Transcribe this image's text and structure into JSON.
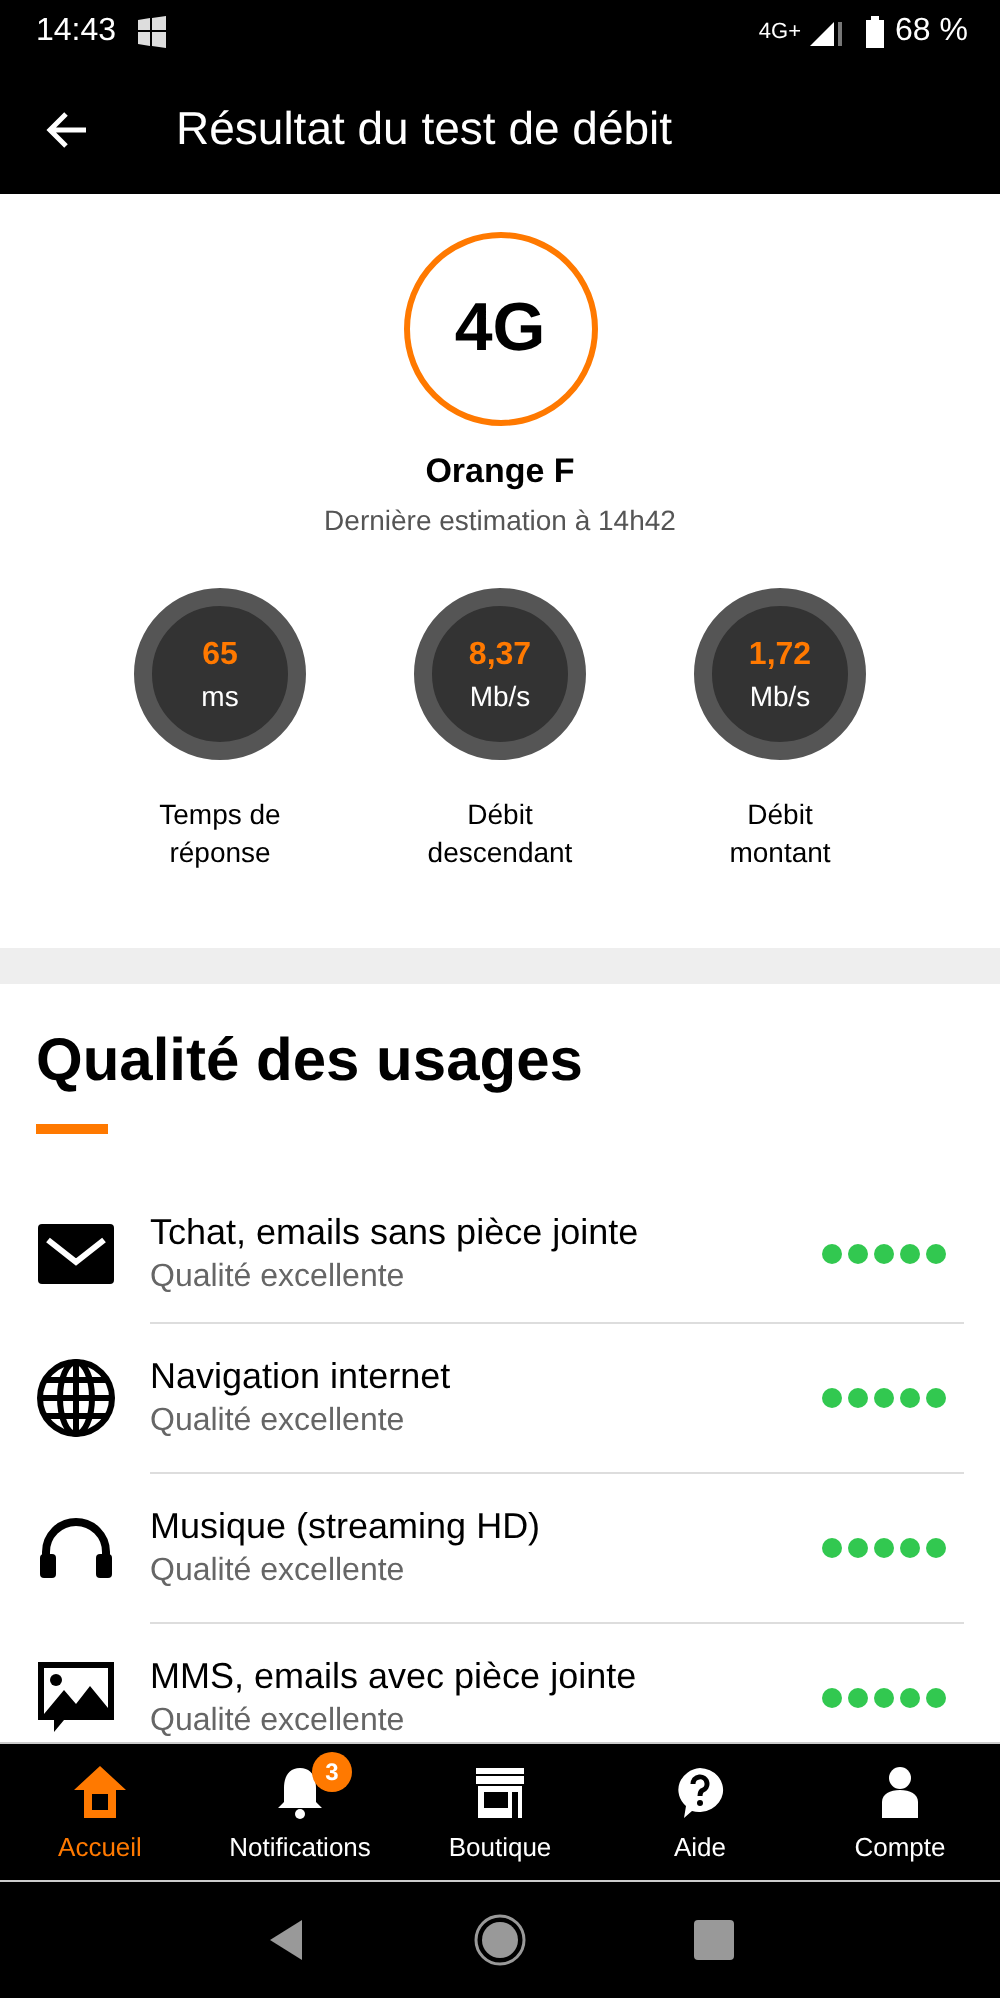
{
  "status_bar": {
    "time": "14:43",
    "network": "4G+",
    "battery": "68 %"
  },
  "app_bar": {
    "title": "Résultat du test de débit"
  },
  "network": {
    "badge": "4G",
    "operator": "Orange F",
    "estimate": "Dernière estimation à 14h42"
  },
  "metrics": [
    {
      "value": "65",
      "unit": "ms",
      "label": "Temps de réponse"
    },
    {
      "value": "8,37",
      "unit": "Mb/s",
      "label": "Débit descendant"
    },
    {
      "value": "1,72",
      "unit": "Mb/s",
      "label": "Débit montant"
    }
  ],
  "usages": {
    "title": "Qualité des usages",
    "items": [
      {
        "kind": "mail",
        "name": "Tchat, emails sans pièce jointe",
        "quality": "Qualité excellente",
        "stars": 5
      },
      {
        "kind": "globe",
        "name": "Navigation internet",
        "quality": "Qualité excellente",
        "stars": 5
      },
      {
        "kind": "music",
        "name": "Musique (streaming HD)",
        "quality": "Qualité excellente",
        "stars": 5
      },
      {
        "kind": "image",
        "name": "MMS, emails avec pièce jointe",
        "quality": "Qualité excellente",
        "stars": 5
      }
    ]
  },
  "tabs": [
    {
      "kind": "home",
      "label": "Accueil",
      "selected": true
    },
    {
      "kind": "bell",
      "label": "Notifications",
      "selected": false,
      "badge": "3"
    },
    {
      "kind": "shop",
      "label": "Boutique",
      "selected": false
    },
    {
      "kind": "help",
      "label": "Aide",
      "selected": false
    },
    {
      "kind": "account",
      "label": "Compte",
      "selected": false
    }
  ]
}
